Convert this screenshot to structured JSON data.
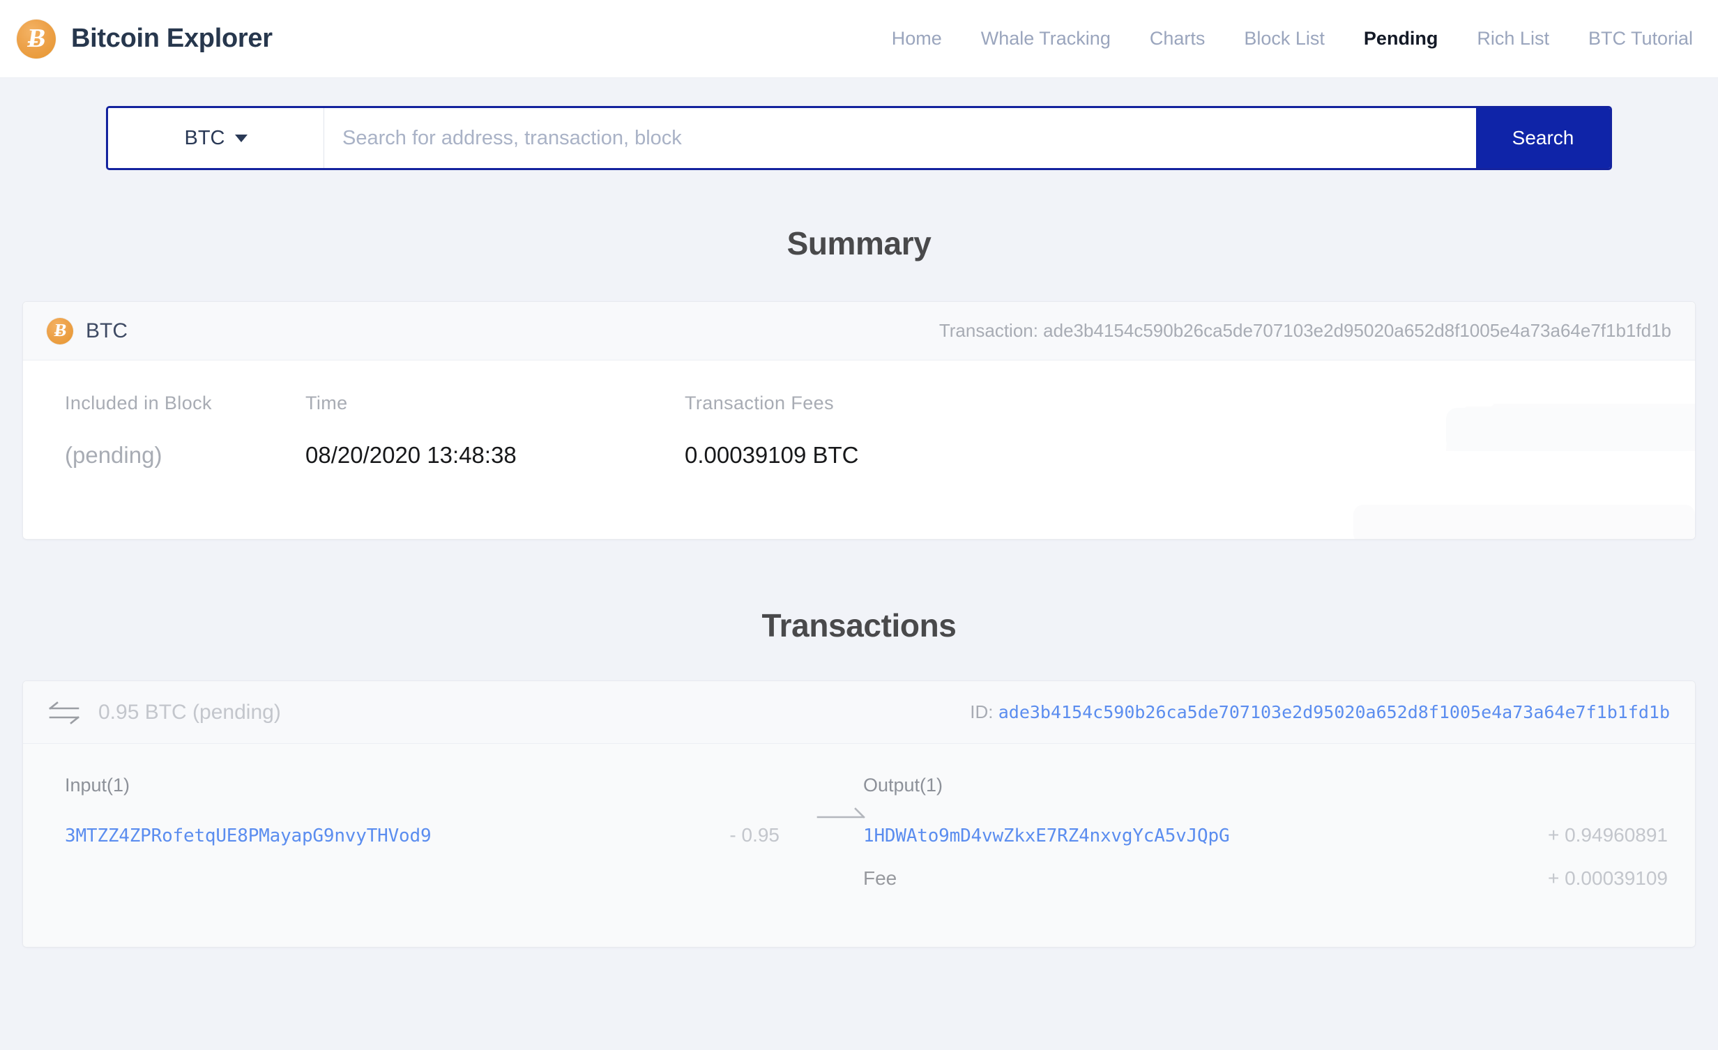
{
  "header": {
    "logo_icon": "bitcoin-coin-icon",
    "logo_glyph": "Ƀ",
    "brand": "Bitcoin Explorer",
    "nav": [
      {
        "label": "Home",
        "active": false
      },
      {
        "label": "Whale Tracking",
        "active": false
      },
      {
        "label": "Charts",
        "active": false
      },
      {
        "label": "Block List",
        "active": false
      },
      {
        "label": "Pending",
        "active": true
      },
      {
        "label": "Rich List",
        "active": false
      },
      {
        "label": "BTC Tutorial",
        "active": false
      }
    ]
  },
  "search": {
    "coin_selected": "BTC",
    "coin_caret_icon": "chevron-down-icon",
    "placeholder": "Search for address, transaction, block",
    "value": "",
    "button_label": "Search",
    "button_color": "#0f24a8",
    "border_color": "#14239e"
  },
  "summary": {
    "section_title": "Summary",
    "coin_icon": "bitcoin-coin-icon",
    "coin_label": "BTC",
    "transaction_line": "Transaction: ade3b4154c590b26ca5de707103e2d95020a652d8f1005e4a73a64e7f1b1fd1b",
    "fields": [
      {
        "label": "Included in Block",
        "value": "(pending)",
        "muted": true
      },
      {
        "label": "Time",
        "value": "08/20/2020 13:48:38",
        "muted": false
      },
      {
        "label": "Transaction Fees",
        "value": "0.00039109 BTC",
        "muted": false
      }
    ]
  },
  "transactions": {
    "section_title": "Transactions",
    "swap_icon": "swap-arrows-icon",
    "amount_label": "0.95 BTC (pending)",
    "id_prefix": "ID:",
    "id_value": "ade3b4154c590b26ca5de707103e2d95020a652d8f1005e4a73a64e7f1b1fd1b",
    "id_color": "#5b8def",
    "arrow_icon": "arrow-right-icon",
    "input": {
      "title": "Input(1)",
      "rows": [
        {
          "address": "3MTZZ4ZPRofetqUE8PMayapG9nvyTHVod9",
          "amount": "- 0.95",
          "is_link": true
        }
      ]
    },
    "output": {
      "title": "Output(1)",
      "rows": [
        {
          "address": "1HDWAto9mD4vwZkxE7RZ4nxvgYcA5vJQpG",
          "amount": "+ 0.94960891",
          "is_link": true
        },
        {
          "address": "Fee",
          "amount": "+ 0.00039109",
          "is_link": false
        }
      ]
    }
  }
}
